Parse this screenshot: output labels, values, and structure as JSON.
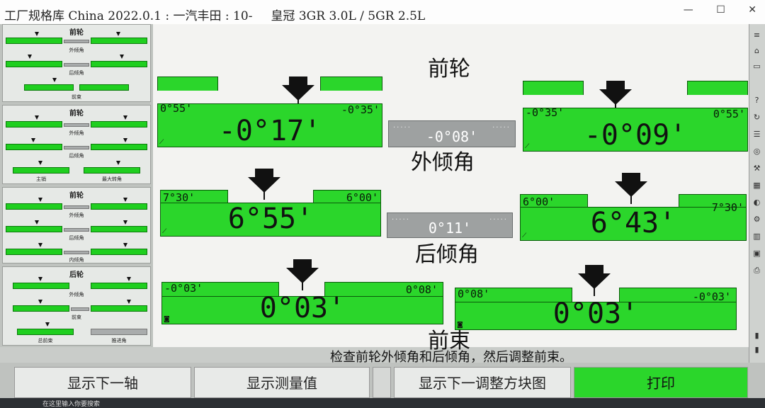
{
  "title": {
    "library": "工厂规格库 China 2022.0.1 : 一汽丰田 : 10-",
    "vehicle": "皇冠 3GR 3.0L / 5GR 2.5L"
  },
  "window_buttons": [
    "—",
    "☐",
    "✕"
  ],
  "sidebar": {
    "thumbs": [
      {
        "title": "前轮",
        "labels": [
          "外倾角",
          "后倾角",
          "前束"
        ]
      },
      {
        "title": "前轮",
        "labels": [
          "外倾角",
          "后倾角",
          "主销",
          "最大转角"
        ]
      },
      {
        "title": "前轮",
        "labels": [
          "外倾角",
          "后倾角",
          "内倾角"
        ]
      },
      {
        "title": "后轮",
        "labels": [
          "外倾角",
          "前束",
          "总前束",
          "推进角"
        ]
      }
    ]
  },
  "main": {
    "title": "前轮",
    "camber": {
      "label": "外倾角",
      "left": {
        "min": "0°55'",
        "max": "-0°35'",
        "value": "-0°17'"
      },
      "right": {
        "min": "-0°35'",
        "max": "0°55'",
        "value": "-0°09'"
      },
      "diff": "-0°08'"
    },
    "caster": {
      "label": "后倾角",
      "left": {
        "min": "7°30'",
        "max": "6°00'",
        "value": "6°55'"
      },
      "right": {
        "min": "6°00'",
        "max": "7°30'",
        "value": "6°43'"
      },
      "diff": "0°11'"
    },
    "toe": {
      "label": "前束",
      "left": {
        "min": "-0°03'",
        "max": "0°08'",
        "value": "0°03'"
      },
      "right": {
        "min": "0°08'",
        "max": "-0°03'",
        "value": "0°03'"
      }
    }
  },
  "instruction": "检查前轮外倾角和后倾角，然后调整前束。",
  "buttons": {
    "next_axle": "显示下一轴",
    "show_measure": "显示测量值",
    "next_block": "显示下一调整方块图",
    "print": "打印"
  },
  "taskbar": {
    "search": "在这里输入你要搜索"
  },
  "colors": {
    "in_spec": "#2bd62b",
    "neutral": "#9ea1a1",
    "background": "#f3f3f1"
  }
}
